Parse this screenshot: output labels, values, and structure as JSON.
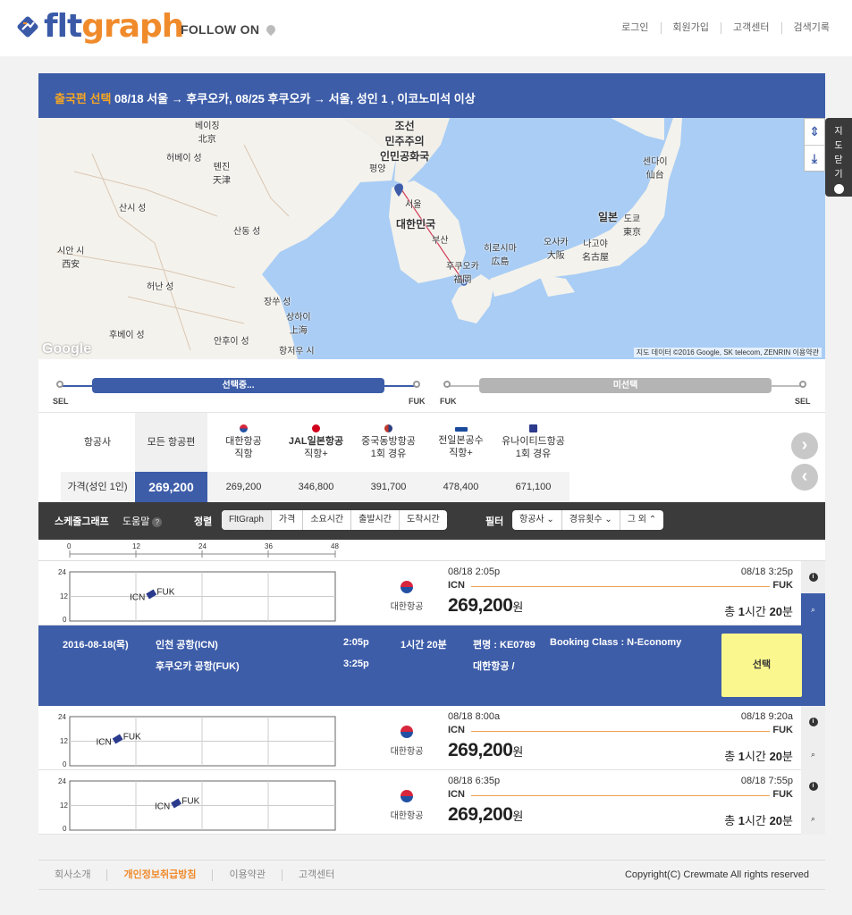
{
  "header": {
    "logo_part1": "flt",
    "logo_part2": "graph",
    "follow_label": "FOLLOW ON",
    "nav": [
      "로그인",
      "회원가입",
      "고객센터",
      "검색기록"
    ]
  },
  "banner": {
    "highlight": "출국편 선택",
    "text": " 08/18 서울 → 후쿠오카, 08/25 후쿠오카 → 서울, 성인 1 , 이코노미석 이상"
  },
  "map": {
    "labels": [
      {
        "t": "베이징\n北京",
        "cls": ""
      },
      {
        "t": "허베이 성",
        "cls": ""
      },
      {
        "t": "톈진\n天津",
        "cls": ""
      },
      {
        "t": "산시 성",
        "cls": ""
      },
      {
        "t": "산동 성",
        "cls": ""
      },
      {
        "t": "시안 시\n西安",
        "cls": ""
      },
      {
        "t": "허난 성",
        "cls": ""
      },
      {
        "t": "후베이 성",
        "cls": ""
      },
      {
        "t": "안후이 성",
        "cls": ""
      },
      {
        "t": "장쑤 성",
        "cls": ""
      },
      {
        "t": "상하이\n上海",
        "cls": ""
      },
      {
        "t": "항저우 시",
        "cls": ""
      },
      {
        "t": "조선\n민주주의\n인민공화국",
        "cls": "big"
      },
      {
        "t": "평양",
        "cls": ""
      },
      {
        "t": "서울",
        "cls": ""
      },
      {
        "t": "대한민국",
        "cls": "big"
      },
      {
        "t": "부산",
        "cls": ""
      },
      {
        "t": "후쿠오카\n福岡",
        "cls": ""
      },
      {
        "t": "히로시마\n広島",
        "cls": ""
      },
      {
        "t": "오사카\n大阪",
        "cls": ""
      },
      {
        "t": "나고야\n名古屋",
        "cls": ""
      },
      {
        "t": "일본",
        "cls": "big"
      },
      {
        "t": "도쿄\n東京",
        "cls": ""
      },
      {
        "t": "센다이\n仙台",
        "cls": ""
      }
    ],
    "google": "Google",
    "copyright": "지도 데이터 ©2016 Google, SK telecom, ZENRIN    이용약관",
    "close_label": "지도닫기"
  },
  "route": {
    "outbound_from": "SEL",
    "outbound_to": "FUK",
    "outbound_status": "선택중...",
    "return_from": "FUK",
    "return_to": "SEL",
    "return_status": "미선택"
  },
  "airlines": {
    "row_header": "항공사",
    "price_header": "가격(성인 1인)",
    "columns": [
      {
        "name": "모든 항공편",
        "sub": "",
        "price": "269,200",
        "color": ""
      },
      {
        "name": "대한항공",
        "sub": "직항",
        "price": "269,200",
        "color": "#d7263d"
      },
      {
        "name": "JAL일본항공",
        "sub": "직항+",
        "price": "346,800",
        "color": "#d0021b"
      },
      {
        "name": "중국동방항공",
        "sub": "1회 경유",
        "price": "391,700",
        "color": "#c0392b"
      },
      {
        "name": "전일본공수",
        "sub": "직항+",
        "price": "478,400",
        "color": "#1a4a9c"
      },
      {
        "name": "유나이티드항공",
        "sub": "1회 경유",
        "price": "671,100",
        "color": "#2b3a8c"
      }
    ]
  },
  "sortbar": {
    "schedule_label": "스케줄그래프",
    "help_label": "도움말",
    "sort_label": "정렬",
    "sort_options": [
      "FltGraph",
      "가격",
      "소요시간",
      "출발시간",
      "도착시간"
    ],
    "filter_label": "필터",
    "filter_options": [
      "항공사 ⌄",
      "경유횟수 ⌄",
      "그 외 ⌃"
    ]
  },
  "axis_ticks": [
    "0",
    "12",
    "24",
    "36",
    "48"
  ],
  "y_ticks": [
    "24",
    "12",
    "0"
  ],
  "flights": [
    {
      "airline": "대한항공",
      "dep_time": "08/18 2:05p",
      "arr_time": "08/18 3:25p",
      "from": "ICN",
      "to": "FUK",
      "price": "269,200",
      "currency": "원",
      "dur_prefix": "총",
      "dur_h": "1",
      "dur_h_unit": "시간",
      "dur_m": "20",
      "dur_m_unit": "분",
      "dep_hour": 14.08,
      "arr_hour": 15.42
    },
    {
      "airline": "대한항공",
      "dep_time": "08/18 8:00a",
      "arr_time": "08/18 9:20a",
      "from": "ICN",
      "to": "FUK",
      "price": "269,200",
      "currency": "원",
      "dur_prefix": "총",
      "dur_h": "1",
      "dur_h_unit": "시간",
      "dur_m": "20",
      "dur_m_unit": "분",
      "dep_hour": 8.0,
      "arr_hour": 9.33
    },
    {
      "airline": "대한항공",
      "dep_time": "08/18 6:35p",
      "arr_time": "08/18 7:55p",
      "from": "ICN",
      "to": "FUK",
      "price": "269,200",
      "currency": "원",
      "dur_prefix": "총",
      "dur_h": "1",
      "dur_h_unit": "시간",
      "dur_m": "20",
      "dur_m_unit": "분",
      "dep_hour": 18.58,
      "arr_hour": 19.92
    }
  ],
  "detail": {
    "date": "2016-08-18(목)",
    "dep_airport": "인천 공항(ICN)",
    "arr_airport": "후쿠오카 공항(FUK)",
    "dep_time": "2:05p",
    "arr_time": "3:25p",
    "duration": "1시간 20분",
    "flight_no": "편명 : KE0789",
    "booking_class": "Booking Class : N-Economy",
    "carrier": "대한항공 /",
    "select_label": "선택"
  },
  "footer": {
    "links": [
      "회사소개",
      "개인정보취급방침",
      "이용약관",
      "고객센터"
    ],
    "copyright": "Copyright(C) Crewmate All rights reserved"
  },
  "colors": {
    "brand_blue": "#3d5da9",
    "brand_orange": "#f08b2c",
    "select_yellow": "#fbf78f"
  }
}
